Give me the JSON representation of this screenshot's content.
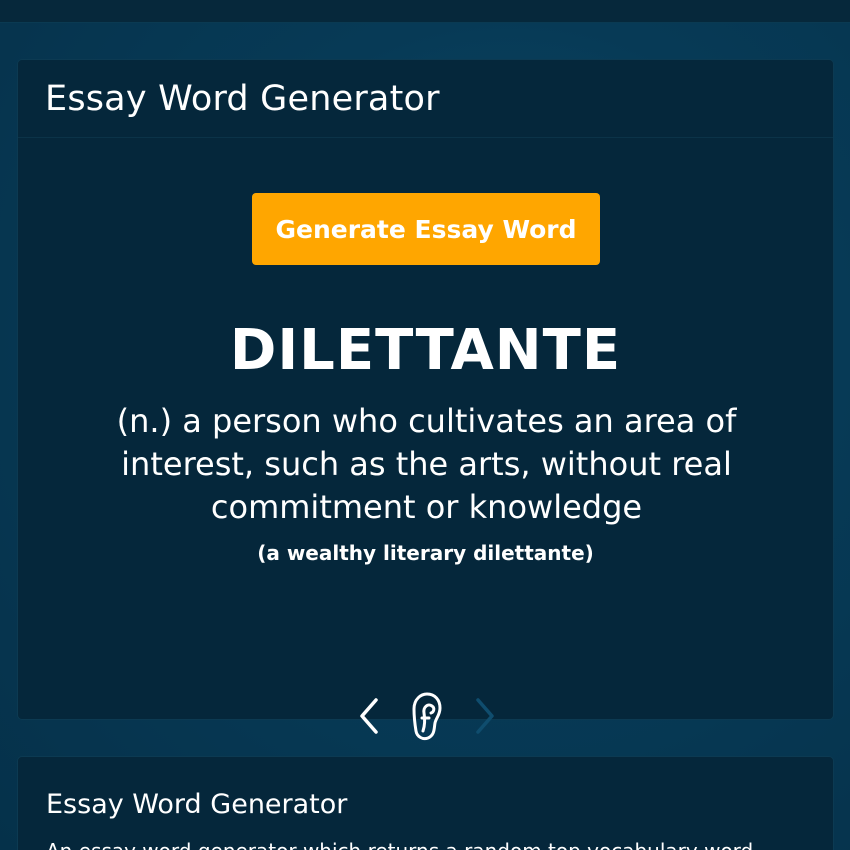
{
  "generator": {
    "title": "Essay Word Generator",
    "button_label": "Generate Essay Word",
    "word": "DILETTANTE",
    "definition": "(n.) a person who cultivates an area of interest, such as the arts, without real commitment or knowledge",
    "example": "(a wealthy literary dilettante)",
    "controls": {
      "prev_icon": "chevron-left-icon",
      "listen_icon": "ear-icon",
      "next_icon": "chevron-right-icon",
      "next_disabled": true
    }
  },
  "about": {
    "title": "Essay Word Generator",
    "text": "An essay word generator which returns a random top vocabulary word"
  },
  "colors": {
    "background": "#073a56",
    "card": "#05273b",
    "accent": "#ffa600",
    "text": "#ffffff",
    "disabled": "#0f4d6e"
  }
}
